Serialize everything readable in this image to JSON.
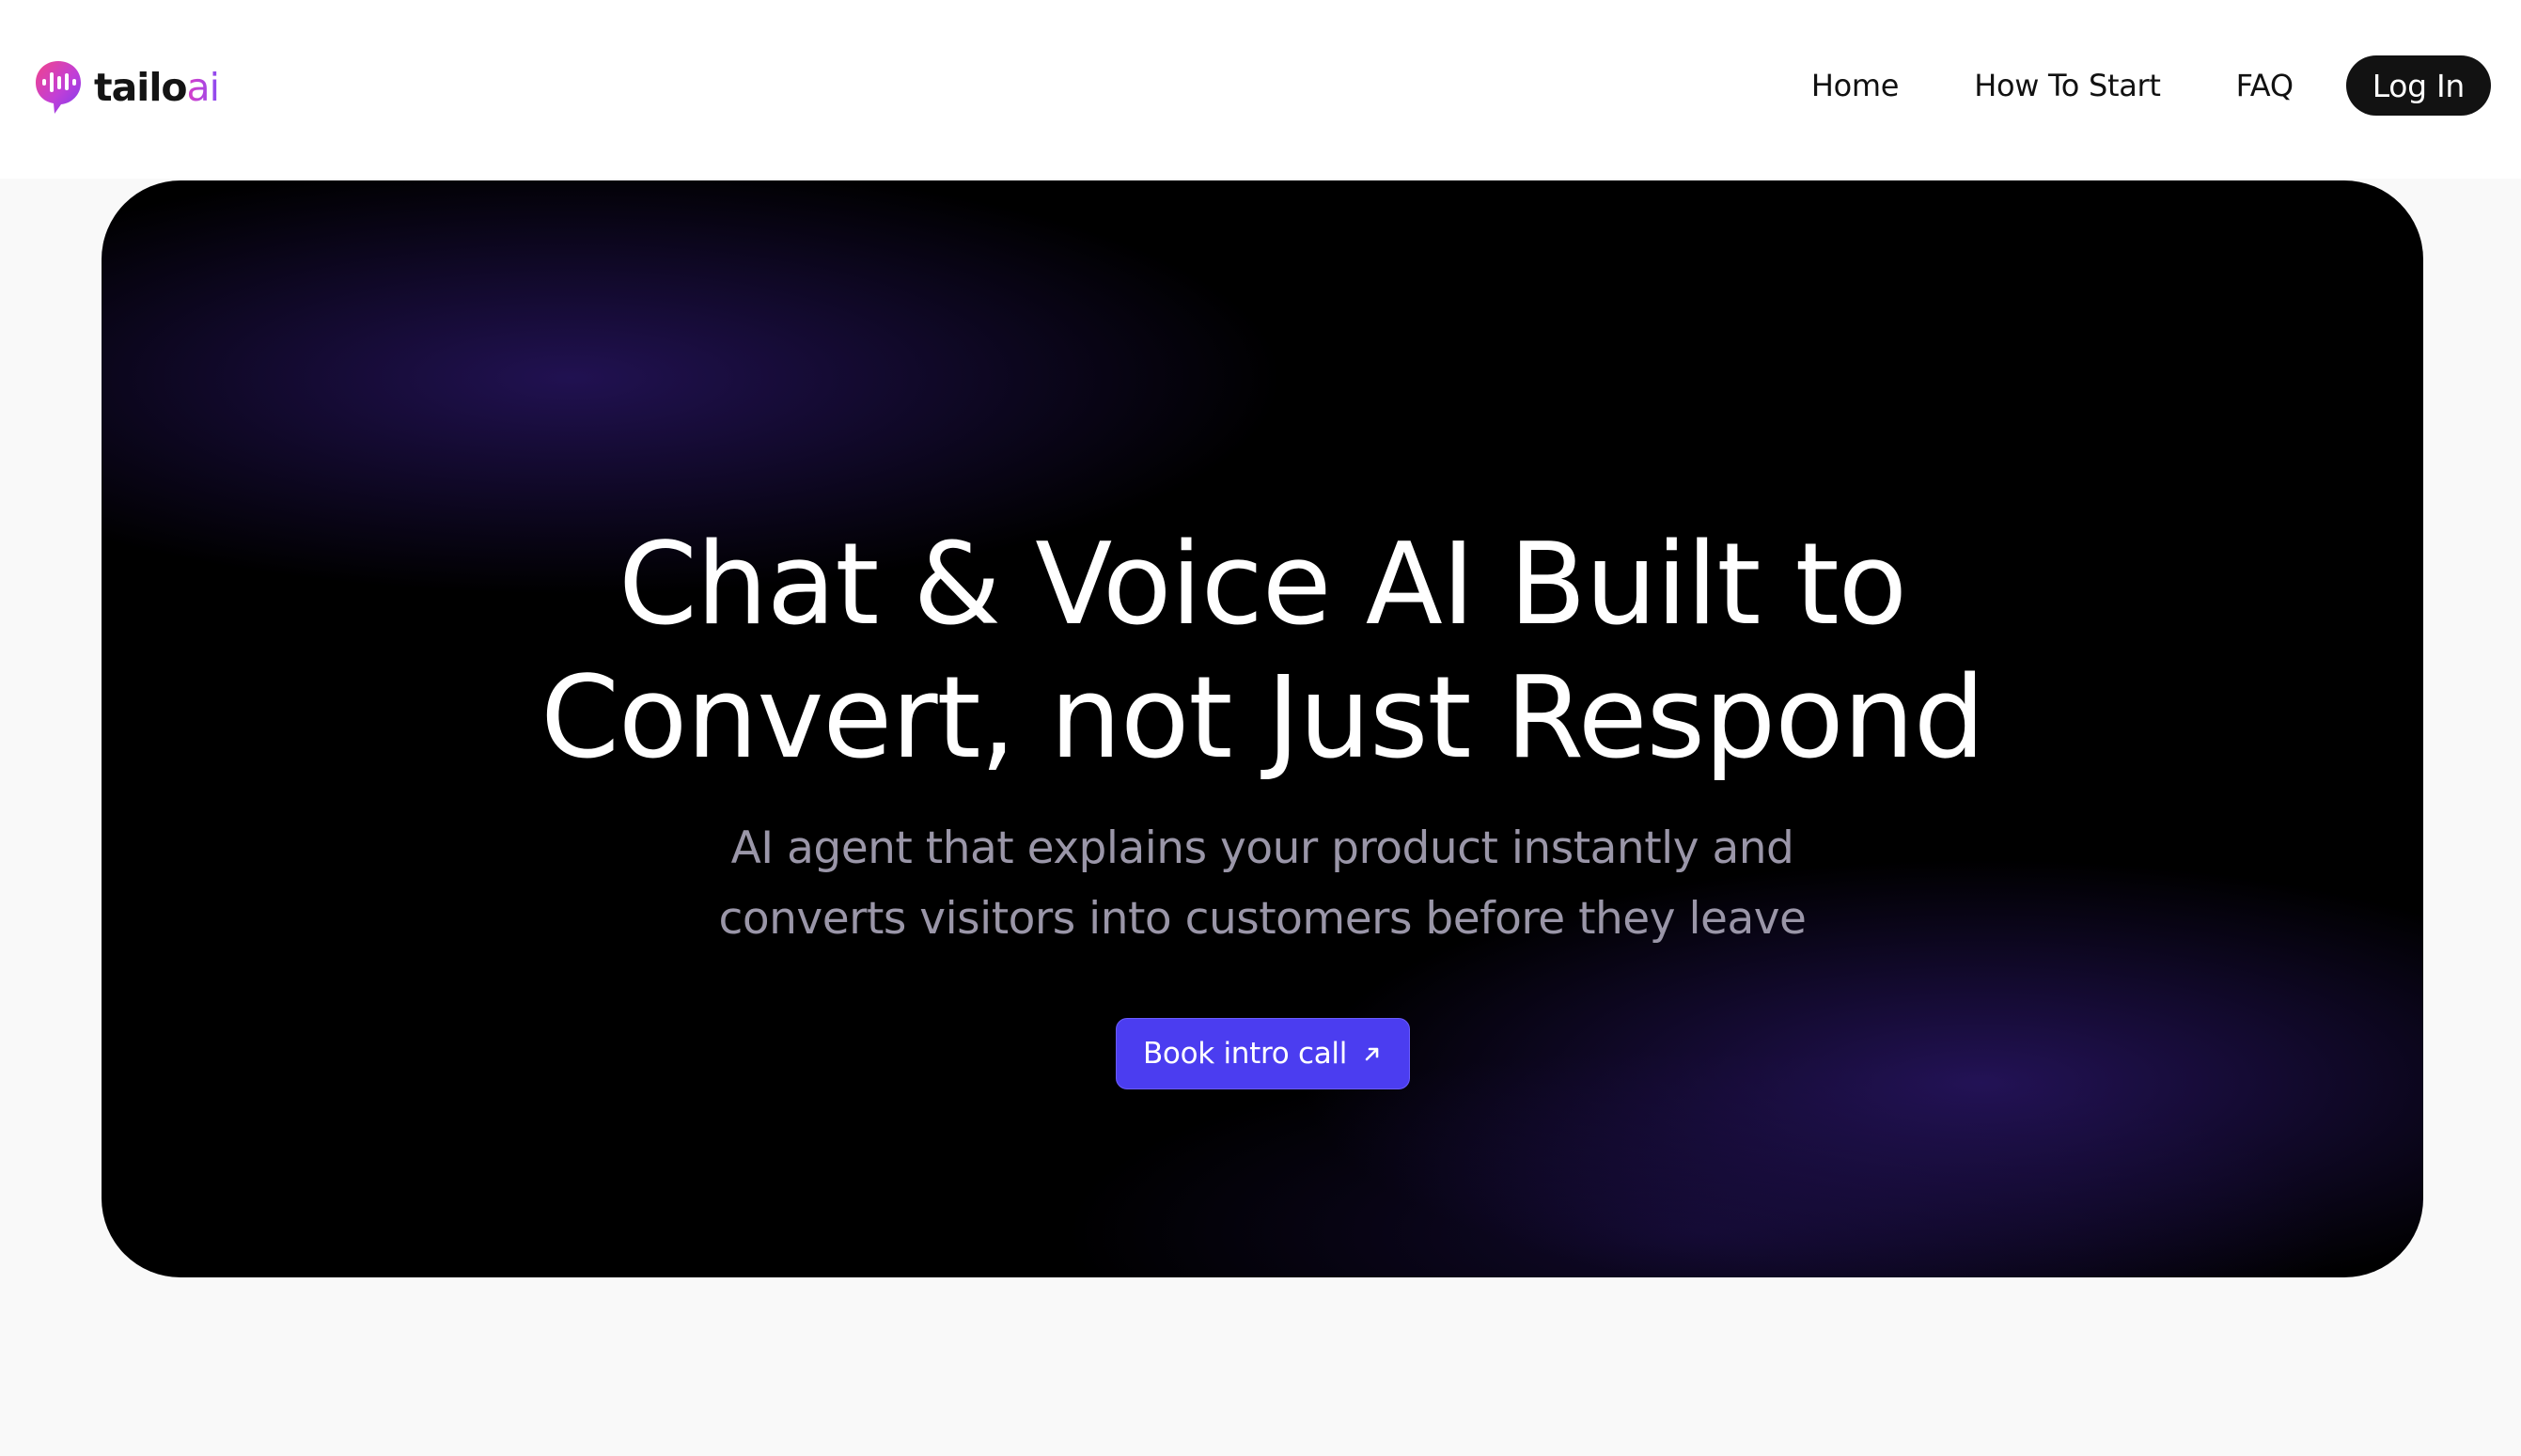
{
  "brand": {
    "name_main": "tailo",
    "name_accent": "ai"
  },
  "nav": {
    "links": [
      {
        "label": "Home"
      },
      {
        "label": "How To Start"
      },
      {
        "label": "FAQ"
      }
    ],
    "login_label": "Log In"
  },
  "hero": {
    "title_line1": "Chat & Voice AI Built to",
    "title_line2": "Convert, not Just Respond",
    "subtitle_line1": "AI agent that explains your product instantly and",
    "subtitle_line2": "converts visitors into customers before they leave",
    "cta_label": "Book intro call",
    "cta_icon": "arrow-up-right-icon"
  },
  "colors": {
    "accent": "#4b3df0",
    "hero_background": "#000000",
    "hero_glow": "#2a1668",
    "page_background": "#f9f9f9",
    "login_button": "#121212"
  }
}
